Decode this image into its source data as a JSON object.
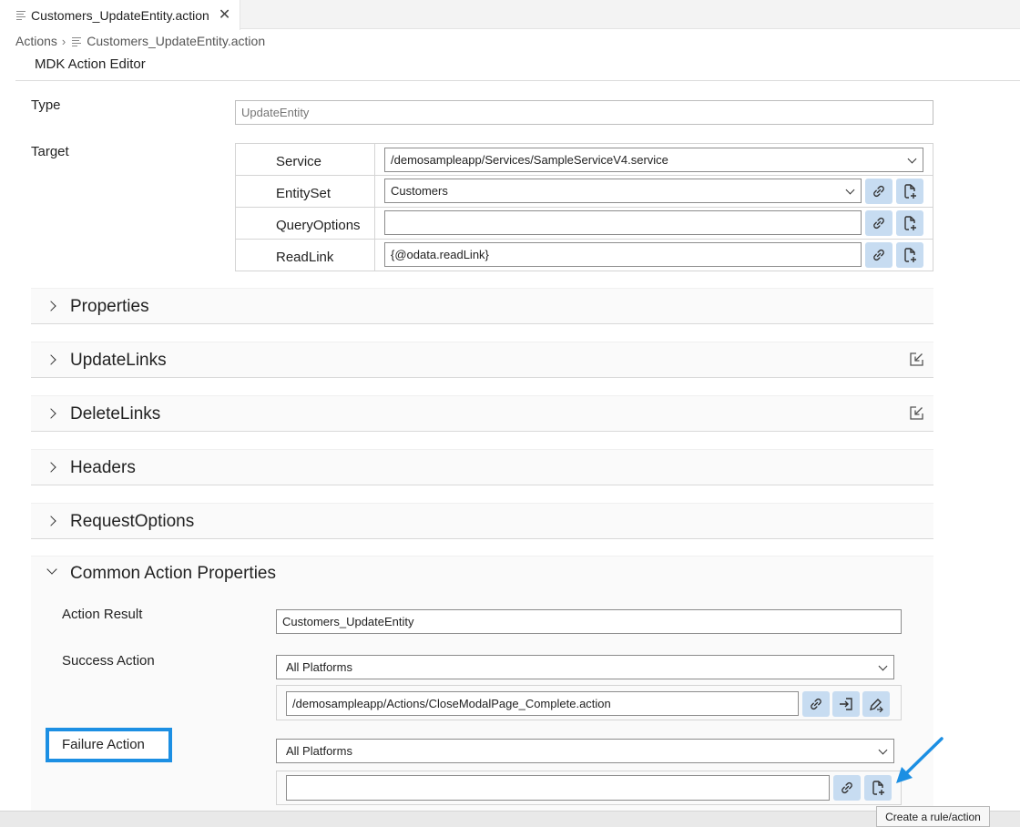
{
  "tab": {
    "label": "Customers_UpdateEntity.action",
    "close": "✕"
  },
  "breadcrumb": {
    "root": "Actions",
    "separator": "›",
    "file": "Customers_UpdateEntity.action"
  },
  "editor": {
    "title": "MDK Action Editor"
  },
  "type": {
    "label": "Type",
    "placeholder": "UpdateEntity"
  },
  "target": {
    "label": "Target",
    "rows": [
      {
        "label": "Service",
        "value": "/demosampleapp/Services/SampleServiceV4.service"
      },
      {
        "label": "EntitySet",
        "value": "Customers"
      },
      {
        "label": "QueryOptions",
        "value": ""
      },
      {
        "label": "ReadLink",
        "value": "{@odata.readLink}"
      }
    ]
  },
  "sections": [
    {
      "title": "Properties",
      "action_icon": ""
    },
    {
      "title": "UpdateLinks",
      "action_icon": "edit-box-icon"
    },
    {
      "title": "DeleteLinks",
      "action_icon": "edit-box-icon"
    },
    {
      "title": "Headers",
      "action_icon": ""
    },
    {
      "title": "RequestOptions",
      "action_icon": ""
    }
  ],
  "common": {
    "title": "Common Action Properties",
    "action_result": {
      "label": "Action Result",
      "value": "Customers_UpdateEntity"
    },
    "success_action": {
      "label": "Success Action",
      "platform": "All Platforms",
      "value": "/demosampleapp/Actions/CloseModalPage_Complete.action"
    },
    "failure_action": {
      "label": "Failure Action",
      "platform": "All Platforms",
      "value": ""
    }
  },
  "tooltip": "Create a rule/action",
  "colors": {
    "button_bg": "#c7dcf1",
    "highlight": "#1c8fe3",
    "arrow": "#1c8fe3"
  }
}
